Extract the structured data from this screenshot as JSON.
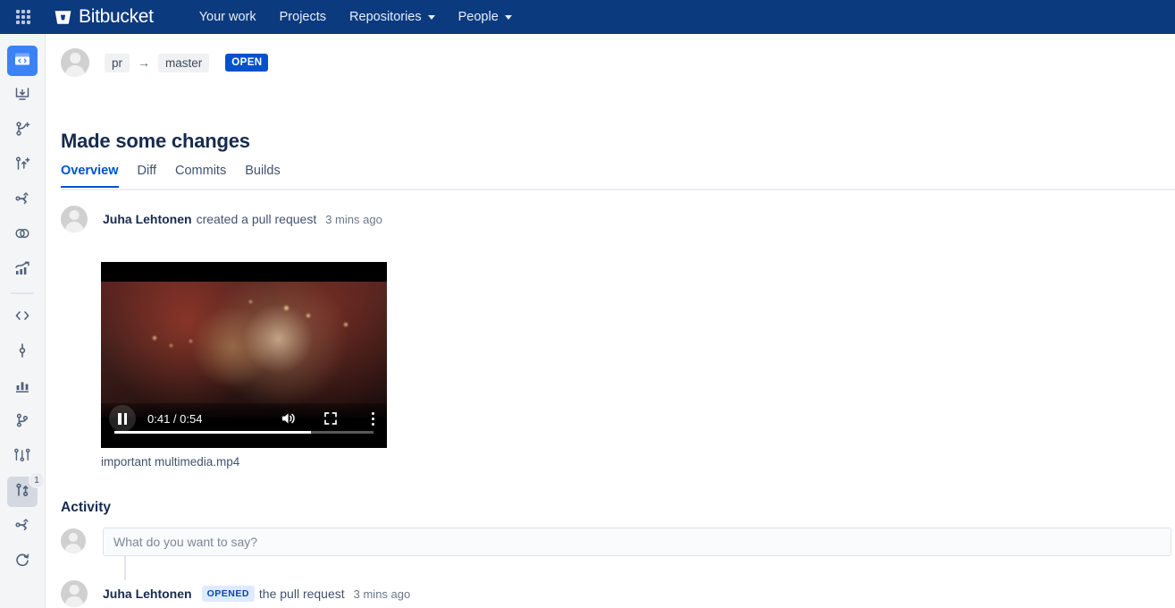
{
  "topnav": {
    "app_switcher_icon": "grid-apps-icon",
    "logo_icon": "bitbucket-logo-icon",
    "brand": "Bitbucket",
    "links": [
      {
        "label": "Your work",
        "has_caret": false
      },
      {
        "label": "Projects",
        "has_caret": false
      },
      {
        "label": "Repositories",
        "has_caret": true
      },
      {
        "label": "People",
        "has_caret": true
      }
    ]
  },
  "sidebar": {
    "items": [
      {
        "icon": "source-code-folder-icon",
        "state": "active-blue",
        "badge": ""
      },
      {
        "icon": "clone-download-icon",
        "state": "",
        "badge": ""
      },
      {
        "icon": "create-branch-icon",
        "state": "",
        "badge": ""
      },
      {
        "icon": "create-pull-request-icon",
        "state": "",
        "badge": ""
      },
      {
        "icon": "fork-repository-icon",
        "state": "",
        "badge": ""
      },
      {
        "icon": "compare-icon",
        "state": "",
        "badge": ""
      },
      {
        "icon": "insights-chart-icon",
        "state": "",
        "badge": ""
      },
      {
        "icon": "source-code-icon",
        "state": "",
        "badge": ""
      },
      {
        "icon": "commits-icon",
        "state": "",
        "badge": ""
      },
      {
        "icon": "bar-chart-icon",
        "state": "",
        "badge": ""
      },
      {
        "icon": "branches-icon",
        "state": "",
        "badge": ""
      },
      {
        "icon": "branch-list-icon",
        "state": "",
        "badge": ""
      },
      {
        "icon": "pull-requests-icon",
        "state": "active-grey",
        "badge": "1"
      },
      {
        "icon": "pipelines-icon",
        "state": "",
        "badge": ""
      },
      {
        "icon": "deployments-sync-icon",
        "state": "",
        "badge": ""
      }
    ]
  },
  "pull_request": {
    "avatar": "user-avatar",
    "source_branch": "pr",
    "arrow": "→",
    "destination_branch": "master",
    "status": "OPEN",
    "title": "Made some changes",
    "tabs": [
      {
        "label": "Overview",
        "active": true
      },
      {
        "label": "Diff",
        "active": false
      },
      {
        "label": "Commits",
        "active": false
      },
      {
        "label": "Builds",
        "active": false
      }
    ],
    "created_event": {
      "author": "Juha Lehtonen",
      "action": "created a pull request",
      "timestamp": "3 mins ago"
    },
    "attachment": {
      "filename": "important multimedia.mp4",
      "video": {
        "play_state_icon": "pause-icon",
        "current_time": "0:41",
        "duration": "0:54",
        "time_display": "0:41 / 0:54",
        "progress_percent": 76,
        "volume_icon": "volume-on-icon",
        "fullscreen_icon": "fullscreen-icon",
        "menu_icon": "more-options-icon"
      }
    }
  },
  "activity": {
    "heading": "Activity",
    "comment_box": {
      "placeholder": "What do you want to say?",
      "value": ""
    },
    "entries": [
      {
        "author": "Juha Lehtonen",
        "badge": "OPENED",
        "action": "the pull request",
        "timestamp": "3 mins ago"
      }
    ]
  },
  "colors": {
    "nav_background": "#0c3a7f",
    "accent_blue": "#0052cc",
    "status_open_bg": "#0052cc",
    "opened_badge_bg": "#deebff",
    "opened_badge_text": "#0747a6",
    "sidebar_background": "#f4f5f7",
    "text_primary": "#172b4d",
    "text_subtle": "#6b778c"
  }
}
